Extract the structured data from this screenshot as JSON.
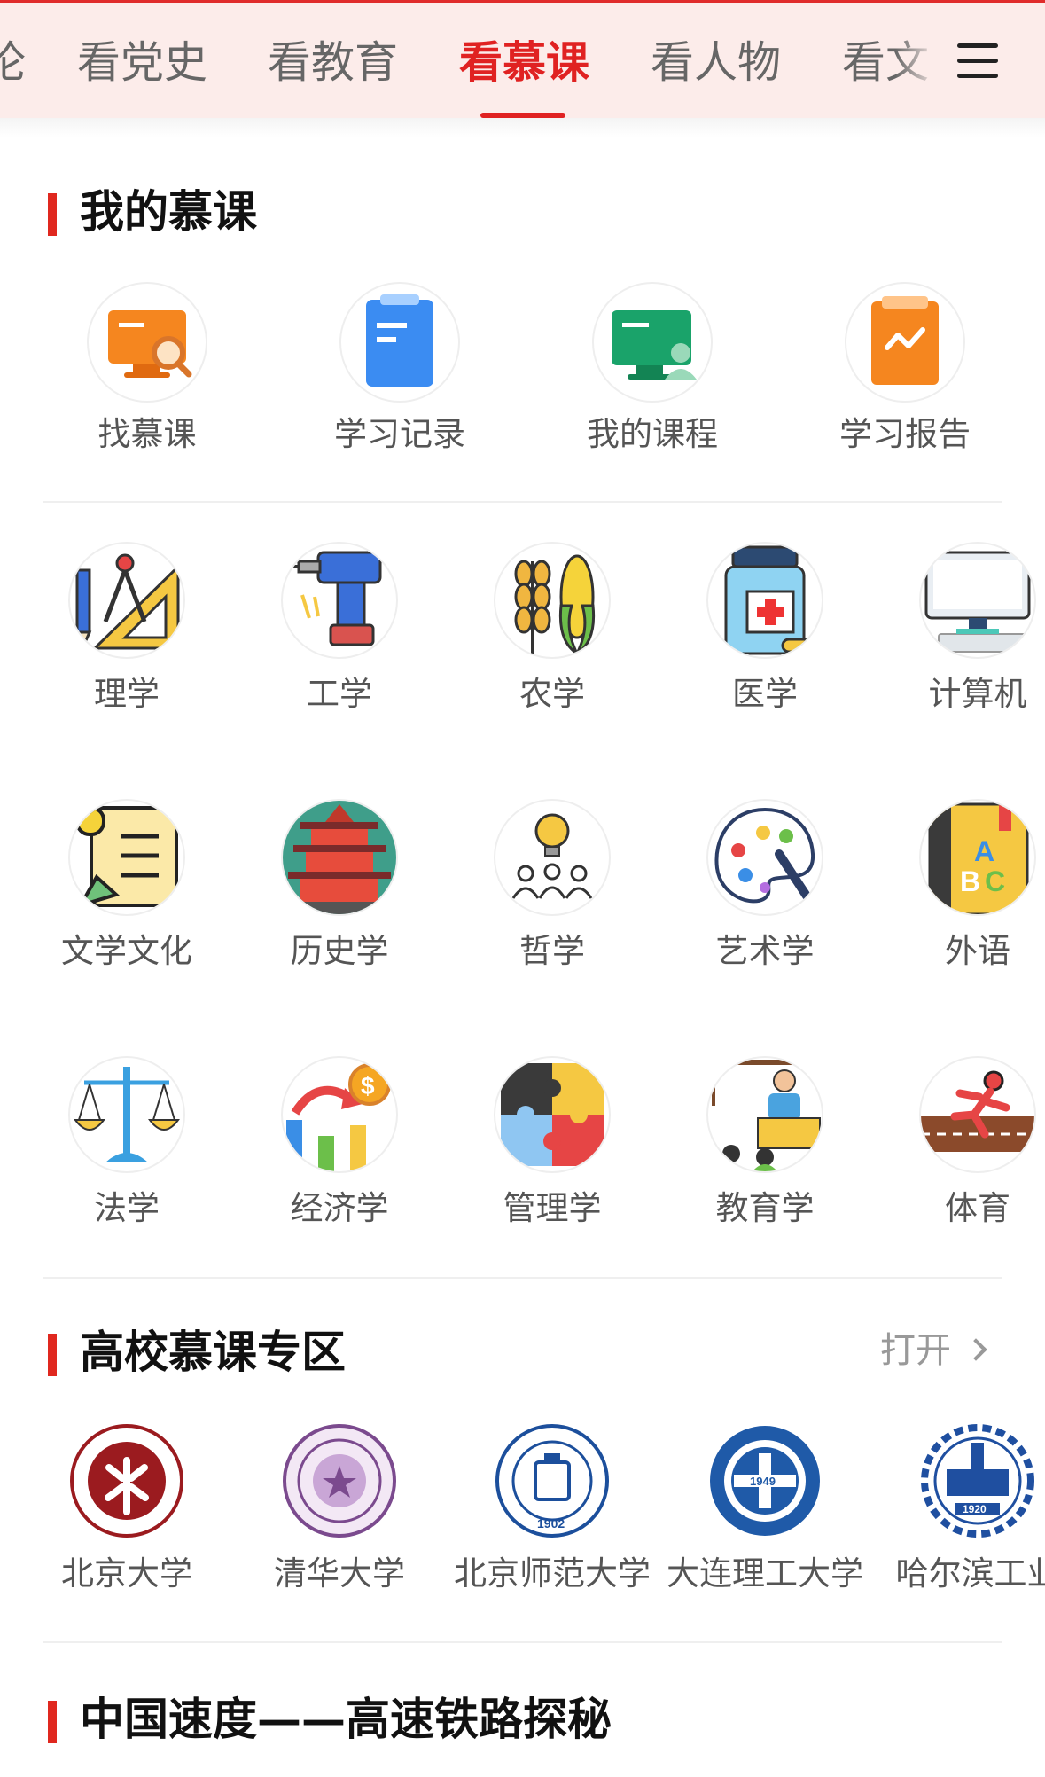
{
  "tabs": [
    {
      "label": "论"
    },
    {
      "label": "看党史"
    },
    {
      "label": "看教育"
    },
    {
      "label": "看慕课",
      "active": true
    },
    {
      "label": "看人物"
    },
    {
      "label": "看文"
    }
  ],
  "my_mooc": {
    "title": "我的慕课",
    "items": [
      {
        "label": "找慕课",
        "icon": "monitor-search-icon"
      },
      {
        "label": "学习记录",
        "icon": "clipboard-icon"
      },
      {
        "label": "我的课程",
        "icon": "monitor-user-icon"
      },
      {
        "label": "学习报告",
        "icon": "report-chart-icon"
      }
    ]
  },
  "subjects": [
    {
      "label": "理学",
      "icon": "compass-ruler-icon"
    },
    {
      "label": "工学",
      "icon": "drill-icon"
    },
    {
      "label": "农学",
      "icon": "wheat-corn-icon"
    },
    {
      "label": "医学",
      "icon": "medicine-bottle-icon"
    },
    {
      "label": "计算机",
      "icon": "computer-icon"
    },
    {
      "label": "文学文化",
      "icon": "scroll-pen-icon"
    },
    {
      "label": "历史学",
      "icon": "pagoda-icon"
    },
    {
      "label": "哲学",
      "icon": "lightbulb-people-icon"
    },
    {
      "label": "艺术学",
      "icon": "palette-icon"
    },
    {
      "label": "外语",
      "icon": "abc-book-icon"
    },
    {
      "label": "法学",
      "icon": "scales-icon"
    },
    {
      "label": "经济学",
      "icon": "growth-chart-icon"
    },
    {
      "label": "管理学",
      "icon": "puzzle-icon"
    },
    {
      "label": "教育学",
      "icon": "teacher-icon"
    },
    {
      "label": "体育",
      "icon": "runner-icon"
    }
  ],
  "universities": {
    "title": "高校慕课专区",
    "open_label": "打开",
    "items": [
      {
        "label": "北京大学",
        "icon": "pku-logo-icon",
        "color": "#9b1b1f"
      },
      {
        "label": "清华大学",
        "icon": "tsinghua-logo-icon",
        "color": "#7b4a8e"
      },
      {
        "label": "北京师范大学",
        "icon": "bnu-logo-icon",
        "color": "#1c4f9c"
      },
      {
        "label": "大连理工大学",
        "icon": "dlut-logo-icon",
        "color": "#1f5aa8"
      },
      {
        "label": "哈尔滨工业",
        "icon": "hit-logo-icon",
        "color": "#1f4fa0"
      }
    ]
  },
  "railway": {
    "title": "中国速度——高速铁路探秘"
  },
  "colors": {
    "accent": "#e02222",
    "tab_bg": "#fcecea"
  }
}
